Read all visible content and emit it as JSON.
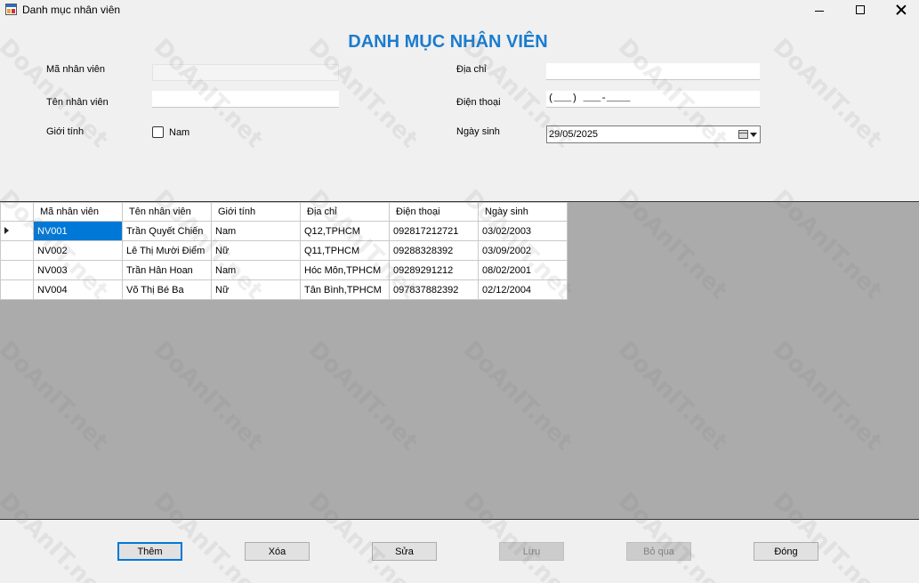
{
  "window": {
    "title": "Danh mục nhân viên",
    "icon": "app-form-icon"
  },
  "form": {
    "heading": "DANH MỤC NHÂN VIÊN",
    "labels": {
      "ma_nv": "Mã nhân viên",
      "ten_nv": "Tên nhân viên",
      "gioi_tinh": "Giới tính",
      "dia_chi": "Địa chỉ",
      "dien_thoai": "Điện thoại",
      "ngay_sinh": "Ngày sinh"
    },
    "values": {
      "ma_nv": "",
      "ten_nv": "",
      "dia_chi": "",
      "dien_thoai_mask": "(___) ___-____",
      "ngay_sinh": "29/05/2025"
    },
    "checkbox_nam_label": "Nam",
    "checkbox_nam_checked": false
  },
  "grid": {
    "columns": [
      "Mã nhân viên",
      "Tên nhân viên",
      "Giới tính",
      "Địa chỉ",
      "Điện thoại",
      "Ngày sinh"
    ],
    "rows": [
      {
        "ma": "NV001",
        "ten": "Trần Quyết Chiến",
        "gt": "Nam",
        "dc": "Q12,TPHCM",
        "dt": "092817212721",
        "ns": "03/02/2003"
      },
      {
        "ma": "NV002",
        "ten": "Lê Thị Mười Điểm",
        "gt": "Nữ",
        "dc": "Q11,TPHCM",
        "dt": "09288328392",
        "ns": "03/09/2002"
      },
      {
        "ma": "NV003",
        "ten": "Trần Hân Hoan",
        "gt": "Nam",
        "dc": "Hóc Môn,TPHCM",
        "dt": "09289291212",
        "ns": "08/02/2001"
      },
      {
        "ma": "NV004",
        "ten": "Võ Thị Bé Ba",
        "gt": "Nữ",
        "dc": "Tân Bình,TPHCM",
        "dt": "097837882392",
        "ns": "02/12/2004"
      }
    ],
    "selected_row": 0
  },
  "buttons": {
    "them": "Thêm",
    "xoa": "Xóa",
    "sua": "Sửa",
    "luu": "Lưu",
    "bo_qua": "Bỏ qua",
    "dong": "Đóng"
  },
  "watermark": "DoAnIT.net",
  "colors": {
    "heading": "#1a7ccf",
    "selection": "#0078d7",
    "grid_background": "#ababab"
  }
}
